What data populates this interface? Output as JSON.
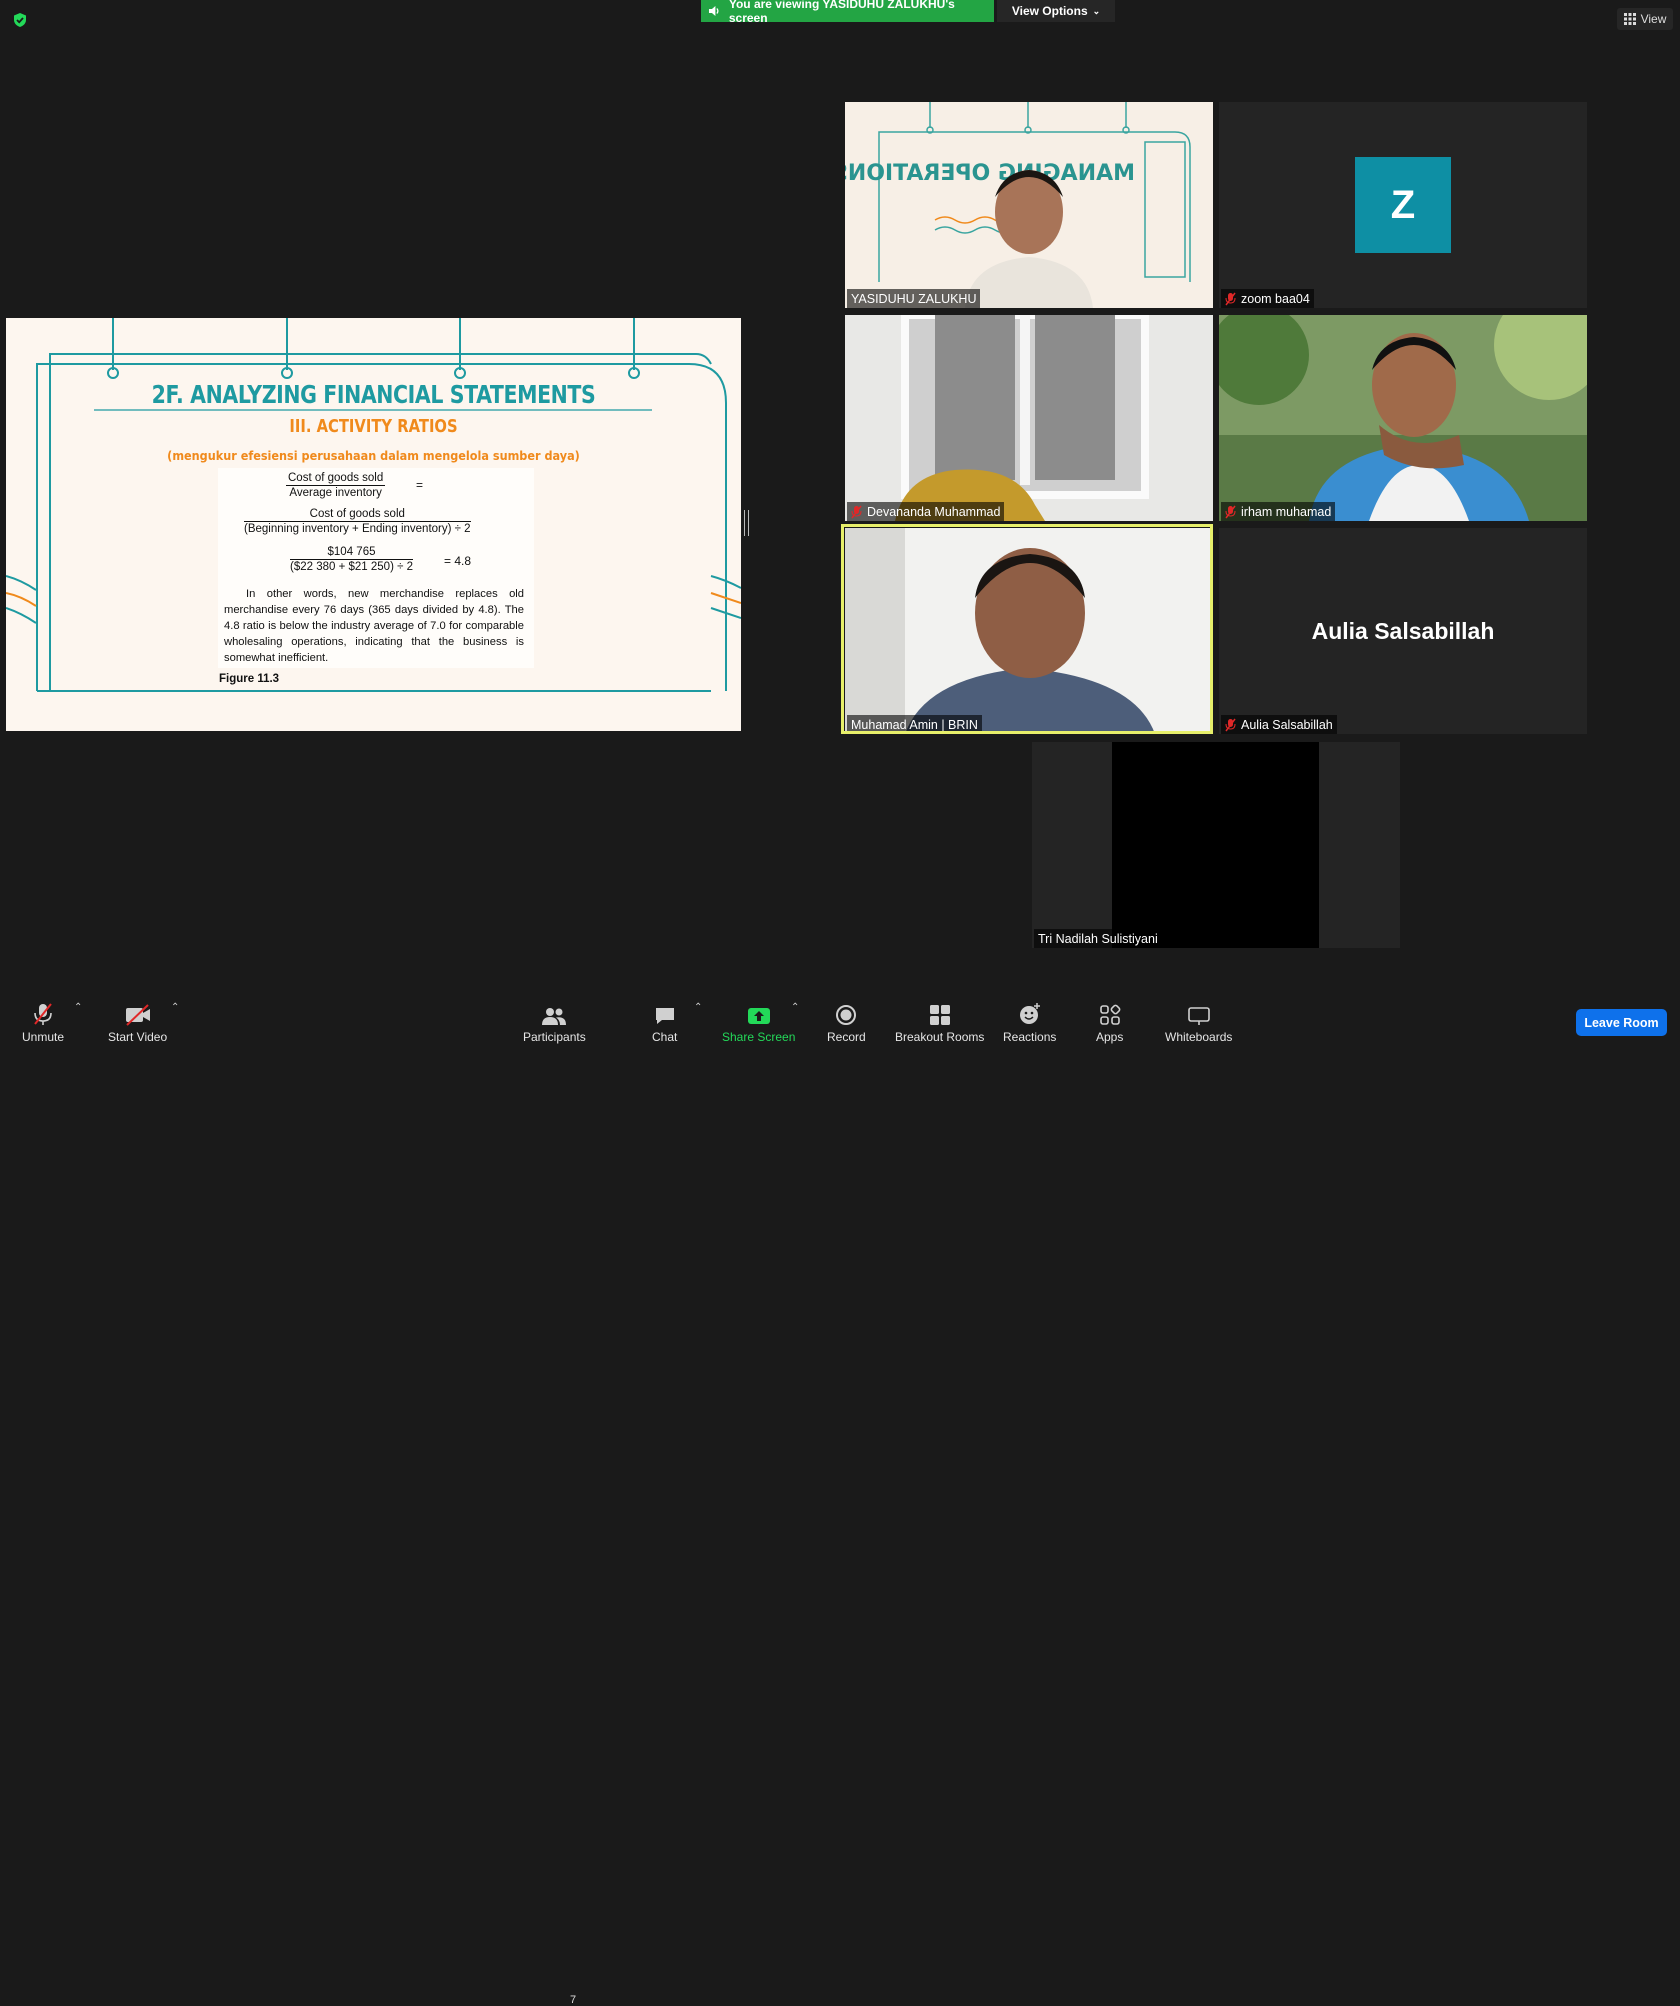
{
  "top_bar": {
    "viewing_banner": "You are viewing YASIDUHU ZALUKHU's screen",
    "view_options_label": "View Options",
    "view_label": "View"
  },
  "shared_slide": {
    "title": "2F. ANALYZING FINANCIAL STATEMENTS",
    "subtitle": "III. ACTIVITY RATIOS",
    "parenthetical": "(mengukur efesiensi perusahaan dalam mengelola sumber daya)",
    "formula1_num": "Cost of goods sold",
    "formula1_den": "Average inventory",
    "formula1_eq": "=",
    "formula2_num": "Cost of goods sold",
    "formula2_den": "(Beginning inventory + Ending inventory) ÷ 2",
    "formula3_num": "$104 765",
    "formula3_den": "($22 380 + $21 250) ÷ 2",
    "formula3_result": "= 4.8",
    "paragraph": "In other words, new merchandise replaces old merchandise every 76 days (365 days divided by 4.8). The 4.8 ratio is below the industry average of 7.0 for comparable wholesaling operations, indicating that the business is somewhat inefficient.",
    "figure_label": "Figure 11.3",
    "colors": {
      "teal": "#1e9aa1",
      "orange": "#f08a1c",
      "background": "#fdf6ef"
    }
  },
  "participants_grid": {
    "yasiduhu": {
      "name": "YASIDUHU ZALUKHU",
      "muted": false
    },
    "zoom": {
      "name": "zoom baa04",
      "avatar_letter": "Z",
      "muted": true
    },
    "devananda": {
      "name": "Devananda Muhammad",
      "muted": true
    },
    "irham": {
      "name": "irham muhamad",
      "muted": true
    },
    "muhamad": {
      "name": "Muhamad Amin | BRIN",
      "muted": false,
      "active_speaker": true
    },
    "aulia": {
      "name": "Aulia Salsabillah",
      "display_name_large": "Aulia Salsabillah",
      "muted": true
    },
    "tri": {
      "name": "Tri Nadilah Sulistiyani",
      "muted": false
    }
  },
  "toolbar": {
    "unmute": "Unmute",
    "start_video": "Start Video",
    "participants": "Participants",
    "participants_count": "7",
    "chat": "Chat",
    "share_screen": "Share Screen",
    "record": "Record",
    "breakout_rooms": "Breakout Rooms",
    "reactions": "Reactions",
    "apps": "Apps",
    "whiteboards": "Whiteboards",
    "leave_room": "Leave Room",
    "share_screen_color": "#23d959"
  }
}
